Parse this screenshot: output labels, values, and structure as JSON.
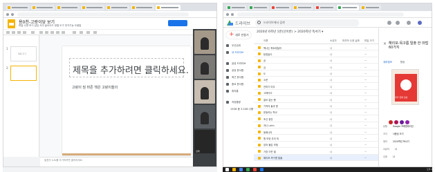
{
  "slides": {
    "doc_title": "용0천-고랑이당 보기",
    "menu": "파일 수정 보기 삽입 서식 슬라이드 정렬 도구 부가기능 도움말",
    "slide_numbers": [
      "1",
      "2"
    ],
    "thumb_text": "제목 추가",
    "slide_title": "제목을 추가하려면 클릭하세요.",
    "slide_subtitle": "고랑이 씽 마존 책은 고랑이들의",
    "notes_placeholder": "발표자 노트를 추가하려면 클릭하세요.",
    "participants": [
      "",
      "",
      "",
      "",
      "김태"
    ]
  },
  "drive": {
    "app_name": "드라이브",
    "search_placeholder": "드라이브에서 검색",
    "new_label": "새로 만들기",
    "sidebar": [
      "우선순위",
      "내 드라이브",
      "공유 드라이브",
      "공유 문서함",
      "최근 문서함",
      "중요 문서함",
      "휴지통",
      "저장용량",
      "15GB 중 3.2GB 사용"
    ],
    "breadcrumb": "2020년 6학년 1반(선이반) > 2020학년 독서기 ▾",
    "columns": [
      "이름",
      "소유자",
      "마지막 수정 날짜",
      "파일 크기"
    ],
    "files": [
      {
        "name": "책나는 북트레일러",
        "owner": "나",
        "size": "—"
      },
      {
        "name": "탐정놀이",
        "owner": "나",
        "size": "—"
      },
      {
        "name": "곰",
        "owner": "나",
        "size": "—"
      },
      {
        "name": "심",
        "owner": "나",
        "size": "—"
      },
      {
        "name": "도",
        "owner": "나",
        "size": "—"
      },
      {
        "name": "소문",
        "owner": "나",
        "size": "—"
      },
      {
        "name": "전하기 미우",
        "owner": "나",
        "size": "—"
      },
      {
        "name": "고래이어",
        "owner": "나",
        "size": "—"
      },
      {
        "name": "쓸모 없는 빵",
        "owner": "나",
        "size": "—"
      },
      {
        "name": "기적의 돌과 왕",
        "owner": "나",
        "size": "—"
      },
      {
        "name": "운동하는 학교",
        "owner": "나",
        "size": "—"
      },
      {
        "name": "조선 종전",
        "owner": "나",
        "size": "—"
      },
      {
        "name": "겨나 Latin",
        "owner": "나",
        "size": "—"
      },
      {
        "name": "동화나라",
        "owner": "나",
        "size": "—"
      },
      {
        "name": "원 모양 우리 외",
        "owner": "나",
        "size": "—"
      },
      {
        "name": "양과 물감 모험",
        "owner": "나",
        "size": "—"
      },
      {
        "name": "가장 이웃 별",
        "owner": "나",
        "size": "—"
      },
      {
        "name": "해리포-목구름 탈출",
        "owner": "나",
        "size": "—"
      }
    ],
    "detail": {
      "title": "해리포-목구름 탈출 한 마법 60가지",
      "tab_details": "세부정보",
      "tab_activity": "활동",
      "book_caption": "쿠키 진짜 장난",
      "meta": [
        {
          "k": "유형",
          "v": "Google 프레젠테이션"
        },
        {
          "k": "크기",
          "v": "사용된 크기"
        },
        {
          "k": "위치",
          "v": "2020학년 독서기"
        },
        {
          "k": "소유자",
          "v": "나"
        },
        {
          "k": "수정",
          "v": "나"
        }
      ]
    },
    "clock": "오후 2:41"
  }
}
